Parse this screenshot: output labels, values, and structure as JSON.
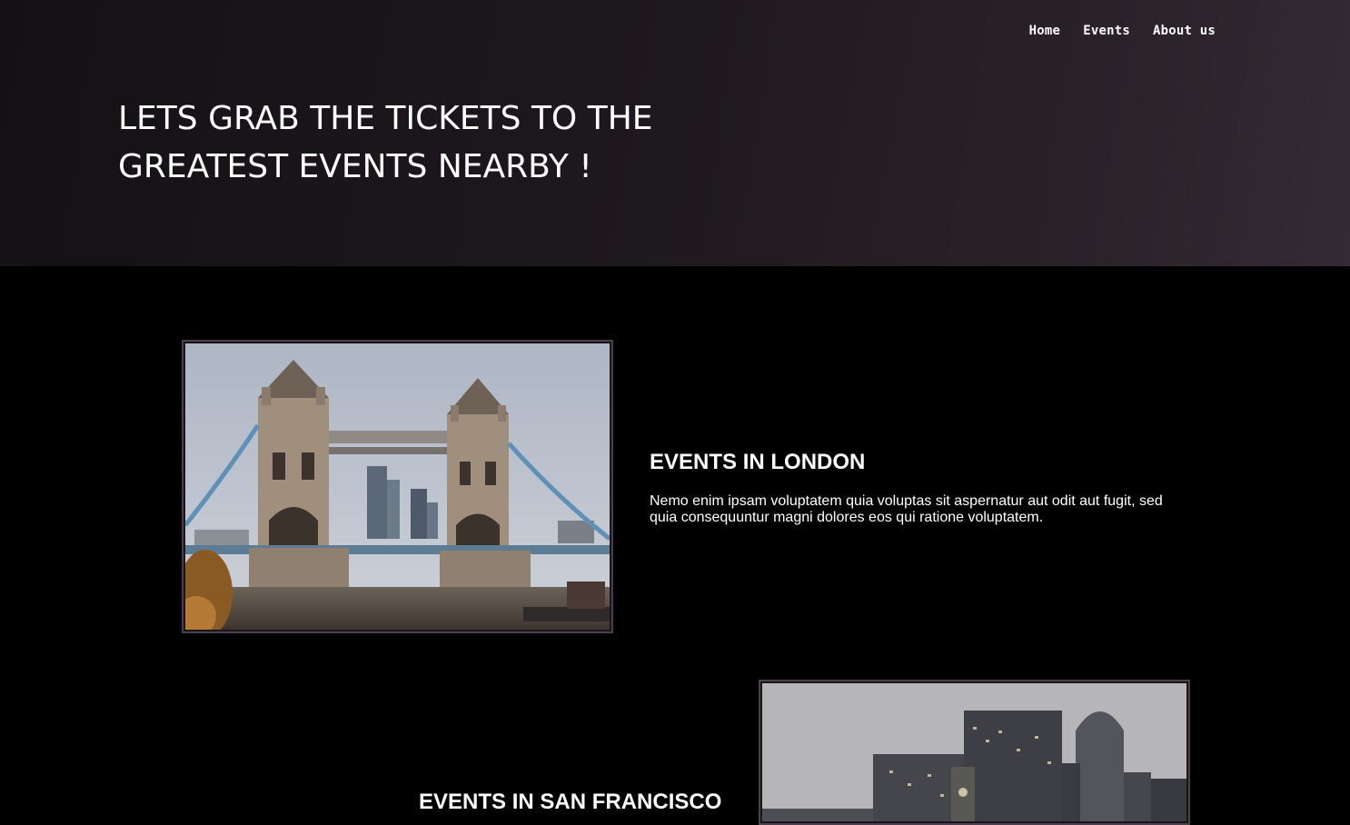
{
  "nav": {
    "items": [
      {
        "label": "Home"
      },
      {
        "label": "Events"
      },
      {
        "label": "About us"
      }
    ]
  },
  "hero": {
    "title": "LETS GRAB THE TICKETS TO THE GREATEST EVENTS NEARBY !"
  },
  "events": [
    {
      "title": "EVENTS IN LONDON",
      "description": "Nemo enim ipsam voluptatem quia voluptas sit aspernatur aut odit aut fugit, sed quia consequuntur magni dolores eos qui ratione voluptatem.",
      "image": "tower-bridge-photo"
    },
    {
      "title": "EVENTS IN SAN FRANCISCO",
      "image": "san-francisco-skyline-photo"
    }
  ]
}
